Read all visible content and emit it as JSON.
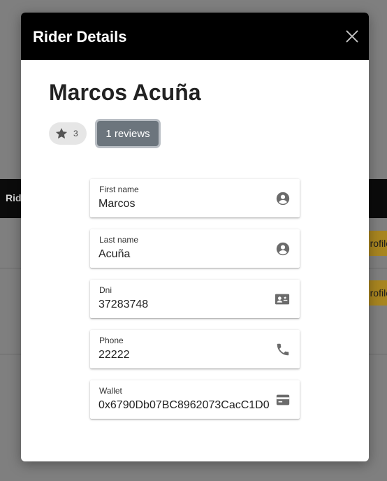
{
  "background": {
    "table_header_text": "Rid",
    "row_badge_text": "rofile"
  },
  "modal": {
    "title": "Rider Details",
    "rider_name": "Marcos Acuña",
    "rating": {
      "icon": "star-icon",
      "value": "3"
    },
    "reviews_button": "1 reviews",
    "fields": [
      {
        "label": "First name",
        "value": "Marcos",
        "icon": "account-circle-icon"
      },
      {
        "label": "Last name",
        "value": "Acuña",
        "icon": "account-circle-icon"
      },
      {
        "label": "Dni",
        "value": "37283748",
        "icon": "id-card-icon"
      },
      {
        "label": "Phone",
        "value": "22222",
        "icon": "phone-icon"
      },
      {
        "label": "Wallet",
        "value": "0x6790Db07BC8962073CacC1D0",
        "icon": "wallet-icon"
      }
    ]
  },
  "colors": {
    "header_bg": "#000000",
    "reviews_button_bg": "#6c757d",
    "overlay": "#7f7f7f",
    "badge": "#a88520"
  }
}
